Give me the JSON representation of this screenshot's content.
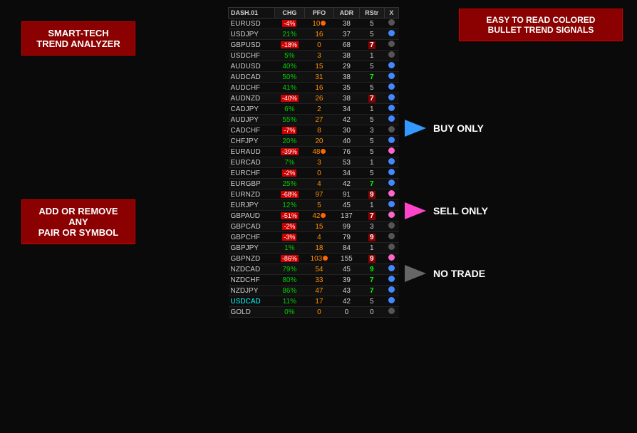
{
  "labels": {
    "smart_tech": "SMART-TECH\nTREND ANALYZER",
    "smart_tech_line1": "SMART-TECH",
    "smart_tech_line2": "TREND ANALYZER",
    "add_remove_line1": "ADD OR REMOVE ANY",
    "add_remove_line2": "PAIR OR SYMBOL",
    "bullet_line1": "EASY TO READ COLORED",
    "bullet_line2": "BULLET TREND SIGNALS",
    "buy_only": "BUY ONLY",
    "sell_only": "SELL ONLY",
    "no_trade": "NO TRADE"
  },
  "table": {
    "header": [
      "DASH.01",
      "CHG",
      "PFO",
      "ADR",
      "RStr",
      "X"
    ],
    "rows": [
      {
        "sym": "EURUSD",
        "chg": "-4%",
        "chg_type": "neg",
        "pfo": "10",
        "pfo_dot": true,
        "adr": "38",
        "rstr": "5",
        "rstr_type": "normal",
        "bullet": "gray"
      },
      {
        "sym": "USDJPY",
        "chg": "21%",
        "chg_type": "pos",
        "pfo": "16",
        "pfo_dot": false,
        "adr": "37",
        "rstr": "5",
        "rstr_type": "normal",
        "bullet": "blue"
      },
      {
        "sym": "GBPUSD",
        "chg": "-18%",
        "chg_type": "neg",
        "pfo": "0",
        "pfo_dot": false,
        "adr": "68",
        "rstr": "7",
        "rstr_type": "red",
        "bullet": "gray"
      },
      {
        "sym": "USDCHF",
        "chg": "5%",
        "chg_type": "pos",
        "pfo": "3",
        "pfo_dot": false,
        "adr": "38",
        "rstr": "1",
        "rstr_type": "normal",
        "bullet": "gray"
      },
      {
        "sym": "AUDUSD",
        "chg": "40%",
        "chg_type": "pos",
        "pfo": "15",
        "pfo_dot": false,
        "adr": "29",
        "rstr": "5",
        "rstr_type": "normal",
        "bullet": "blue"
      },
      {
        "sym": "AUDCAD",
        "chg": "50%",
        "chg_type": "pos",
        "pfo": "31",
        "pfo_dot": false,
        "adr": "38",
        "rstr": "7",
        "rstr_type": "green",
        "bullet": "blue"
      },
      {
        "sym": "AUDCHF",
        "chg": "41%",
        "chg_type": "pos",
        "pfo": "16",
        "pfo_dot": false,
        "adr": "35",
        "rstr": "5",
        "rstr_type": "normal",
        "bullet": "blue"
      },
      {
        "sym": "AUDNZD",
        "chg": "-40%",
        "chg_type": "neg",
        "pfo": "26",
        "pfo_dot": false,
        "adr": "38",
        "rstr": "7",
        "rstr_type": "red",
        "bullet": "blue"
      },
      {
        "sym": "CADJPY",
        "chg": "6%",
        "chg_type": "pos",
        "pfo": "2",
        "pfo_dot": false,
        "adr": "34",
        "rstr": "1",
        "rstr_type": "normal",
        "bullet": "blue"
      },
      {
        "sym": "AUDJPY",
        "chg": "55%",
        "chg_type": "pos",
        "pfo": "27",
        "pfo_dot": false,
        "adr": "42",
        "rstr": "5",
        "rstr_type": "normal",
        "bullet": "blue"
      },
      {
        "sym": "CADCHF",
        "chg": "-7%",
        "chg_type": "neg",
        "pfo": "8",
        "pfo_dot": false,
        "adr": "30",
        "rstr": "3",
        "rstr_type": "normal",
        "bullet": "gray"
      },
      {
        "sym": "CHFJPY",
        "chg": "20%",
        "chg_type": "pos",
        "pfo": "20",
        "pfo_dot": false,
        "adr": "40",
        "rstr": "5",
        "rstr_type": "normal",
        "bullet": "blue"
      },
      {
        "sym": "EURAUD",
        "chg": "-39%",
        "chg_type": "neg",
        "pfo": "48",
        "pfo_dot": true,
        "adr": "76",
        "rstr": "5",
        "rstr_type": "normal",
        "bullet": "pink"
      },
      {
        "sym": "EURCAD",
        "chg": "7%",
        "chg_type": "pos",
        "pfo": "3",
        "pfo_dot": false,
        "adr": "53",
        "rstr": "1",
        "rstr_type": "normal",
        "bullet": "blue"
      },
      {
        "sym": "EURCHF",
        "chg": "-2%",
        "chg_type": "neg",
        "pfo": "0",
        "pfo_dot": false,
        "adr": "34",
        "rstr": "5",
        "rstr_type": "normal",
        "bullet": "blue"
      },
      {
        "sym": "EURGBP",
        "chg": "25%",
        "chg_type": "pos",
        "pfo": "4",
        "pfo_dot": false,
        "adr": "42",
        "rstr": "7",
        "rstr_type": "green",
        "bullet": "blue"
      },
      {
        "sym": "EURNZD",
        "chg": "-68%",
        "chg_type": "neg",
        "pfo": "97",
        "pfo_dot": false,
        "adr": "91",
        "rstr": "9",
        "rstr_type": "red",
        "bullet": "pink"
      },
      {
        "sym": "EURJPY",
        "chg": "12%",
        "chg_type": "pos",
        "pfo": "5",
        "pfo_dot": false,
        "adr": "45",
        "rstr": "1",
        "rstr_type": "normal",
        "bullet": "blue"
      },
      {
        "sym": "GBPAUD",
        "chg": "-51%",
        "chg_type": "neg",
        "pfo": "42",
        "pfo_dot": true,
        "adr": "137",
        "rstr": "7",
        "rstr_type": "red",
        "bullet": "pink"
      },
      {
        "sym": "GBPCAD",
        "chg": "-2%",
        "chg_type": "neg",
        "pfo": "15",
        "pfo_dot": false,
        "adr": "99",
        "rstr": "3",
        "rstr_type": "normal",
        "bullet": "gray"
      },
      {
        "sym": "GBPCHF",
        "chg": "-3%",
        "chg_type": "neg",
        "pfo": "4",
        "pfo_dot": false,
        "adr": "79",
        "rstr": "9",
        "rstr_type": "red",
        "bullet": "gray"
      },
      {
        "sym": "GBPJPY",
        "chg": "1%",
        "chg_type": "pos",
        "pfo": "18",
        "pfo_dot": false,
        "adr": "84",
        "rstr": "1",
        "rstr_type": "normal",
        "bullet": "gray"
      },
      {
        "sym": "GBPNZD",
        "chg": "-86%",
        "chg_type": "neg",
        "pfo": "103",
        "pfo_dot": true,
        "adr": "155",
        "rstr": "9",
        "rstr_type": "red",
        "bullet": "pink"
      },
      {
        "sym": "NZDCAD",
        "chg": "79%",
        "chg_type": "pos",
        "pfo": "54",
        "pfo_dot": false,
        "adr": "45",
        "rstr": "9",
        "rstr_type": "green",
        "bullet": "blue"
      },
      {
        "sym": "NZDCHF",
        "chg": "80%",
        "chg_type": "pos",
        "pfo": "33",
        "pfo_dot": false,
        "adr": "39",
        "rstr": "7",
        "rstr_type": "green",
        "bullet": "blue"
      },
      {
        "sym": "NZDJPY",
        "chg": "86%",
        "chg_type": "pos",
        "pfo": "47",
        "pfo_dot": false,
        "adr": "43",
        "rstr": "7",
        "rstr_type": "green",
        "bullet": "blue"
      },
      {
        "sym": "USDCAD",
        "chg": "11%",
        "chg_type": "cyan",
        "pfo": "17",
        "pfo_dot": false,
        "adr": "42",
        "rstr": "5",
        "rstr_type": "normal",
        "bullet": "blue"
      },
      {
        "sym": "GOLD",
        "chg": "0%",
        "chg_type": "pos",
        "pfo": "0",
        "pfo_dot": false,
        "adr": "0",
        "rstr": "0",
        "rstr_type": "normal",
        "bullet": "gray"
      }
    ]
  }
}
